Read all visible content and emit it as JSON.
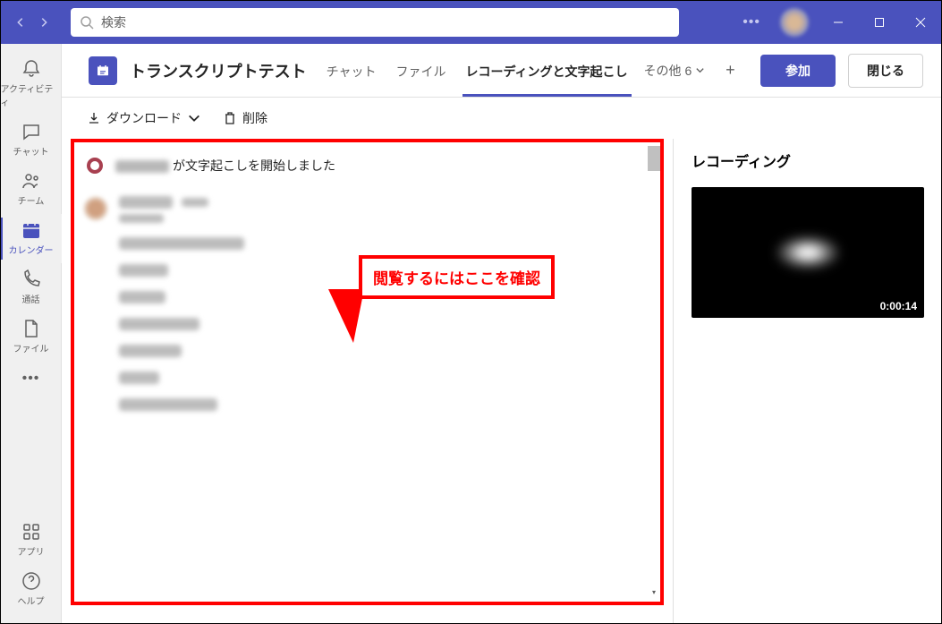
{
  "search": {
    "placeholder": "検索"
  },
  "rail": {
    "activity": "アクティビティ",
    "chat": "チャット",
    "teams": "チーム",
    "calendar": "カレンダー",
    "calls": "通話",
    "files": "ファイル",
    "apps": "アプリ",
    "help": "ヘルプ"
  },
  "meeting": {
    "title": "トランスクリプトテスト",
    "tabs": {
      "chat": "チャット",
      "files": "ファイル",
      "recording": "レコーディングと文字起こし",
      "others_label": "その他",
      "others_count": "6"
    },
    "join": "参加",
    "close": "閉じる"
  },
  "toolbar": {
    "download": "ダウンロード",
    "delete": "削除"
  },
  "transcript": {
    "start_suffix": "が文字起こしを開始しました"
  },
  "callout": {
    "text": "閲覧するにはここを確認"
  },
  "right": {
    "title": "レコーディング",
    "duration": "0:00:14"
  }
}
